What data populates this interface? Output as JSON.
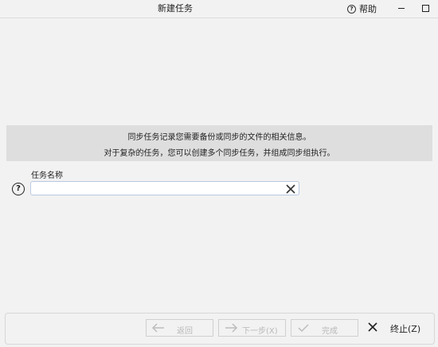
{
  "window": {
    "title": "新建任务",
    "help_label": "帮助"
  },
  "info": {
    "line1": "同步任务记录您需要备份或同步的文件的相关信息。",
    "line2": "对于复杂的任务，您可以创建多个同步任务，并组成同步组执行。"
  },
  "task_name": {
    "label": "任务名称",
    "value": "",
    "placeholder": ""
  },
  "footer": {
    "back_label": "返回",
    "next_label": "下一步(X)",
    "finish_label": "完成",
    "stop_label": "终止(Z)"
  },
  "icons": {
    "help": "help-circle-icon",
    "clear": "close-icon",
    "back": "arrow-left-icon",
    "next": "arrow-right-icon",
    "finish": "checkmark-icon",
    "stop": "close-icon"
  }
}
